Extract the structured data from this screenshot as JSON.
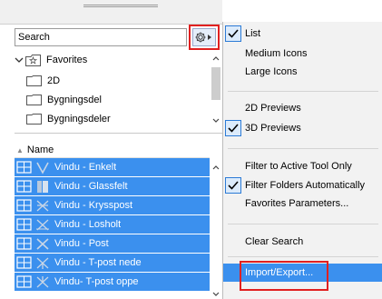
{
  "search": {
    "placeholder": "Search"
  },
  "favorites": {
    "label": "Favorites",
    "items": [
      "2D",
      "Bygningsdel",
      "Bygningsdeler"
    ]
  },
  "list": {
    "column_header": "Name",
    "rows": [
      "Vindu - Enkelt",
      "Vindu - Glassfelt",
      "Vindu - Krysspost",
      "Vindu - Losholt",
      "Vindu - Post",
      "Vindu - T-post nede",
      "Vindu- T-post oppe"
    ]
  },
  "menu": {
    "items": [
      {
        "label": "List",
        "checked": true
      },
      {
        "label": "Medium Icons",
        "checked": false
      },
      {
        "label": "Large Icons",
        "checked": false
      },
      {
        "label": "2D Previews",
        "checked": false
      },
      {
        "label": "3D Previews",
        "checked": true
      },
      {
        "label": "Filter to Active Tool Only",
        "checked": false
      },
      {
        "label": "Filter Folders Automatically",
        "checked": true
      },
      {
        "label": "Favorites Parameters...",
        "checked": false
      },
      {
        "label": "Clear Search",
        "checked": false
      },
      {
        "label": "Import/Export...",
        "checked": false
      }
    ]
  },
  "colors": {
    "selection": "#3b90ee",
    "highlight_border": "#e02020",
    "menu_background": "#f2f2f2"
  },
  "icons": {
    "gear": "gear-icon",
    "checkmark": "checkmark-icon",
    "folder": "folder-icon",
    "favorite_star": "star-icon",
    "object_type": "window-object-icon"
  }
}
